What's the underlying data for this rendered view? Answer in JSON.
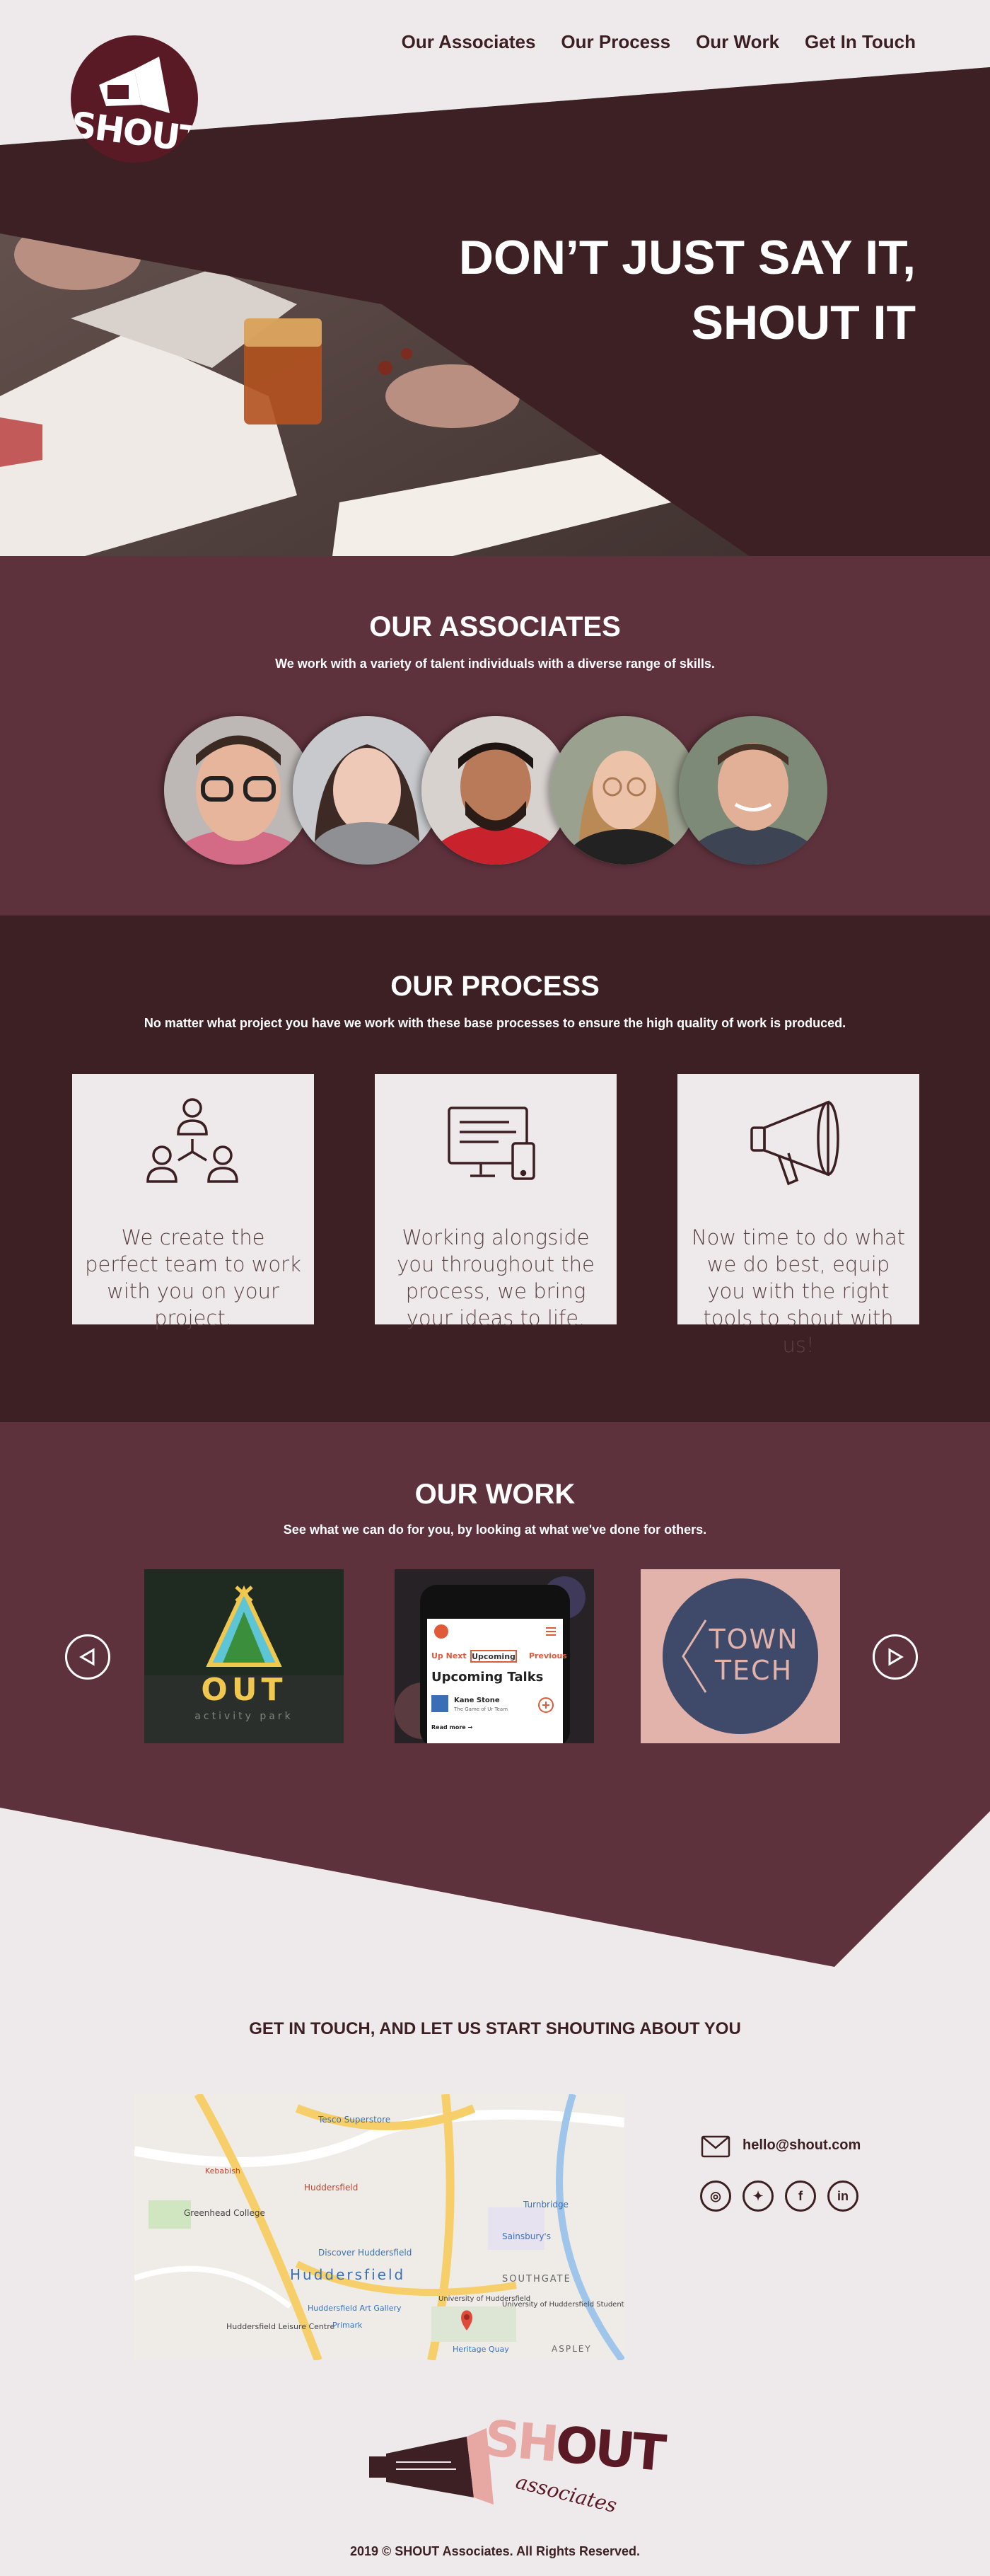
{
  "header": {
    "logo_text": "SHOUT",
    "nav": [
      "Our Associates",
      "Our Process",
      "Our Work",
      "Get In Touch"
    ]
  },
  "hero": {
    "headline_line1": "DON’T JUST SAY IT,",
    "headline_line2": "SHOUT IT"
  },
  "associates": {
    "title": "OUR ASSOCIATES",
    "subtitle": "We work with a variety of talent individuals with a diverse range of skills."
  },
  "process": {
    "title": "OUR PROCESS",
    "subtitle": "No matter what project you have we work with these base processes to ensure the high quality of work is produced.",
    "cards": [
      {
        "icon": "team-icon",
        "text": "We create the perfect team to work with you on your project."
      },
      {
        "icon": "devices-icon",
        "text": "Working alongside you throughout the process, we bring your ideas to life."
      },
      {
        "icon": "megaphone-icon",
        "text": "Now time to do what we do best, equip you with the right tools to shout with us!"
      }
    ]
  },
  "work": {
    "title": "OUR WORK",
    "subtitle": "See what we can do for you, by looking at what we've done for others.",
    "items": [
      {
        "name": "OUT",
        "tagline": "activity park"
      },
      {
        "tab_left": "Up Next",
        "tab_mid": "Upcoming",
        "tab_right": "Previous",
        "heading": "Upcoming Talks",
        "speaker": "Kane Stone",
        "speaker_sub": "The Game of Ur Team",
        "meta": "Read more →"
      },
      {
        "name_line1": "TOWN",
        "name_line2": "TECH"
      }
    ]
  },
  "contact": {
    "title": "GET IN TOUCH, AND LET US START SHOUTING ABOUT YOU",
    "email": "hello@shout.com",
    "socials": [
      "instagram-icon",
      "twitter-icon",
      "facebook-icon",
      "linkedin-icon"
    ],
    "social_glyphs": [
      "◎",
      "✦",
      "f",
      "in"
    ],
    "map_labels": [
      "Tesco Superstore",
      "Huddersfield",
      "Greenhead College",
      "Turnbridge",
      "Sainsbury's",
      "Discover Huddersfield",
      "SOUTHGATE",
      "Huddersfield Art Gallery",
      "University of Huddersfield Students...",
      "University of Huddersfield",
      "Huddersfield Leisure Centre",
      "Primark",
      "Heritage Quay",
      "ASPLEY",
      "Kebabish",
      "Huddersfield"
    ]
  },
  "footer": {
    "brand_a": "SH",
    "brand_b": "OUT",
    "brand_sub": "associates",
    "copyright": "2019 © SHOUT Associates. All Rights Reserved."
  },
  "colors": {
    "dark": "#3c2023",
    "plum": "#5e323c",
    "burgundy": "#5a1a25",
    "light": "#eeeaeb",
    "pink": "#e7a7a3"
  }
}
